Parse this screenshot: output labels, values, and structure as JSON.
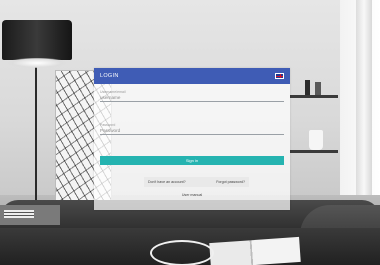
{
  "dialog": {
    "title": "LOGIN",
    "language_icon": "uk-flag-icon"
  },
  "form": {
    "username_label": "Username/email",
    "username_placeholder": "username",
    "password_label": "Password",
    "password_placeholder": "Password",
    "signin_label": "Sign in"
  },
  "links": {
    "no_account": "Don't have an account?",
    "forgot_password": "Forgot password?",
    "user_manual": "User manual"
  },
  "colors": {
    "header": "#3f5cb5",
    "signin_button": "#25b3b0"
  }
}
